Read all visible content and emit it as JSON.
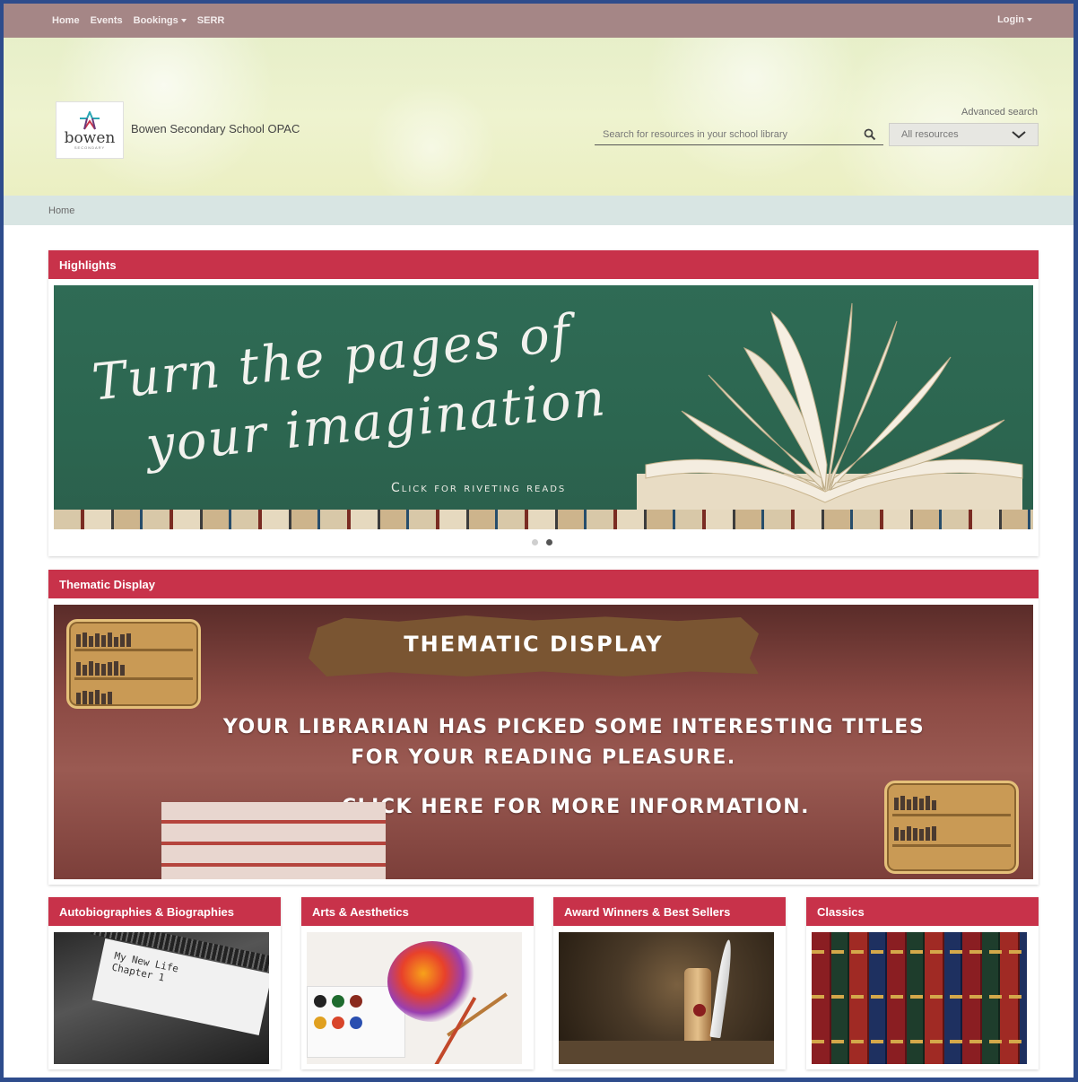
{
  "nav": {
    "items": [
      {
        "label": "Home"
      },
      {
        "label": "Events"
      },
      {
        "label": "Bookings",
        "dropdown": true
      },
      {
        "label": "SERR"
      }
    ],
    "login_label": "Login"
  },
  "header": {
    "logo_word": "bowen",
    "logo_sub": "SECONDARY",
    "site_name": "Bowen Secondary School OPAC",
    "advanced_search": "Advanced search",
    "search_placeholder": "Search for resources in your school library",
    "resource_select": "All resources"
  },
  "breadcrumb": {
    "home": "Home"
  },
  "highlights": {
    "title": "Highlights",
    "banner_line1": "Turn the pages of",
    "banner_line2": "your imagination",
    "banner_sub": "Click for riveting reads",
    "slides": 2,
    "active_slide": 2
  },
  "thematic": {
    "title": "Thematic Display",
    "banner_title": "THEMATIC DISPLAY",
    "line1": "YOUR LIBRARIAN HAS PICKED SOME INTERESTING TITLES",
    "line2": "FOR YOUR READING PLEASURE.",
    "line3": "CLICK HERE FOR MORE INFORMATION."
  },
  "categories": [
    {
      "title": "Autobiographies & Biographies",
      "image_text": "My New Life\nChapter 1"
    },
    {
      "title": "Arts & Aesthetics"
    },
    {
      "title": "Award Winners & Best Sellers"
    },
    {
      "title": "Classics"
    }
  ],
  "colors": {
    "nav_bg": "#a58686",
    "panel_header": "#c8324a",
    "breadcrumb_bg": "#d8e5e3",
    "frame_border": "#2e4c8c"
  }
}
